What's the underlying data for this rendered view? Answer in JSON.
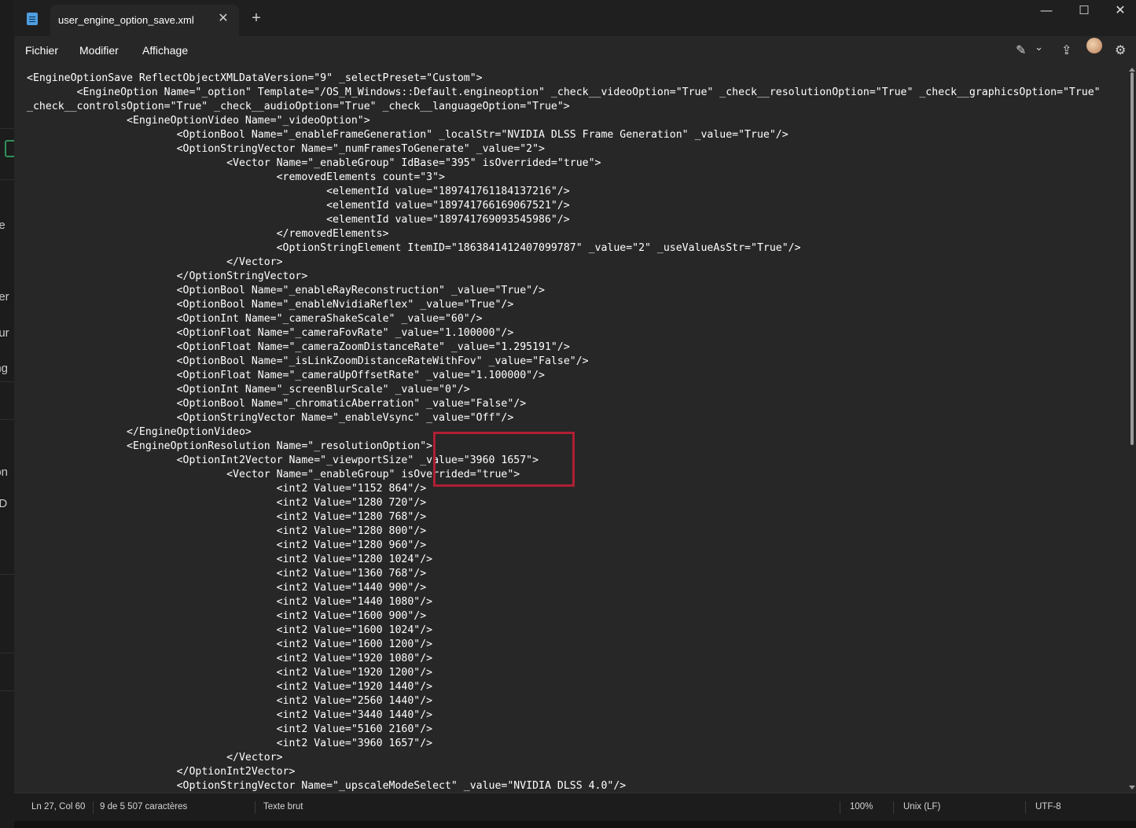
{
  "background_window": {
    "fragments": [
      "ne",
      "ner",
      "our",
      "ing",
      "ion",
      "pD"
    ]
  },
  "titlebar": {
    "tab_title": "user_engine_option_save.xml",
    "close_tab_glyph": "✕",
    "new_tab_glyph": "+",
    "minimize_glyph": "—",
    "maximize_glyph": "☐",
    "close_glyph": "✕"
  },
  "menu": {
    "items": [
      "Fichier",
      "Modifier",
      "Affichage"
    ]
  },
  "toolbar": {
    "copilot_icon": "✎",
    "dropdown_icon": "⌄",
    "share_icon": "⇪",
    "settings_icon": "⚙"
  },
  "document": {
    "lines": [
      "<EngineOptionSave ReflectObjectXMLDataVersion=\"9\" _selectPreset=\"Custom\">",
      "\t<EngineOption Name=\"_option\" Template=\"/OS_M_Windows::Default.engineoption\" _check__videoOption=\"True\" _check__resolutionOption=\"True\" _check__graphicsOption=\"True\"",
      "_check__controlsOption=\"True\" _check__audioOption=\"True\" _check__languageOption=\"True\">",
      "\t\t<EngineOptionVideo Name=\"_videoOption\">",
      "\t\t\t<OptionBool Name=\"_enableFrameGeneration\" _localStr=\"NVIDIA DLSS Frame Generation\" _value=\"True\"/>",
      "\t\t\t<OptionStringVector Name=\"_numFramesToGenerate\" _value=\"2\">",
      "\t\t\t\t<Vector Name=\"_enableGroup\" IdBase=\"395\" isOverrided=\"true\">",
      "\t\t\t\t\t<removedElements count=\"3\">",
      "\t\t\t\t\t\t<elementId value=\"189741761184137216\"/>",
      "\t\t\t\t\t\t<elementId value=\"189741766169067521\"/>",
      "\t\t\t\t\t\t<elementId value=\"189741769093545986\"/>",
      "\t\t\t\t\t</removedElements>",
      "\t\t\t\t\t<OptionStringElement ItemID=\"1863841412407099787\" _value=\"2\" _useValueAsStr=\"True\"/>",
      "\t\t\t\t</Vector>",
      "\t\t\t</OptionStringVector>",
      "\t\t\t<OptionBool Name=\"_enableRayReconstruction\" _value=\"True\"/>",
      "\t\t\t<OptionBool Name=\"_enableNvidiaReflex\" _value=\"True\"/>",
      "\t\t\t<OptionInt Name=\"_cameraShakeScale\" _value=\"60\"/>",
      "\t\t\t<OptionFloat Name=\"_cameraFovRate\" _value=\"1.100000\"/>",
      "\t\t\t<OptionFloat Name=\"_cameraZoomDistanceRate\" _value=\"1.295191\"/>",
      "\t\t\t<OptionBool Name=\"_isLinkZoomDistanceRateWithFov\" _value=\"False\"/>",
      "\t\t\t<OptionFloat Name=\"_cameraUpOffsetRate\" _value=\"1.100000\"/>",
      "\t\t\t<OptionInt Name=\"_screenBlurScale\" _value=\"0\"/>",
      "\t\t\t<OptionBool Name=\"_chromaticAberration\" _value=\"False\"/>",
      "\t\t\t<OptionStringVector Name=\"_enableVsync\" _value=\"Off\"/>",
      "\t\t</EngineOptionVideo>",
      "\t\t<EngineOptionResolution Name=\"_resolutionOption\">",
      "\t\t\t<OptionInt2Vector Name=\"_viewportSize\" _value=\"3960 1657\">",
      "\t\t\t\t<Vector Name=\"_enableGroup\" isOverrided=\"true\">",
      "\t\t\t\t\t<int2 Value=\"1152 864\"/>",
      "\t\t\t\t\t<int2 Value=\"1280 720\"/>",
      "\t\t\t\t\t<int2 Value=\"1280 768\"/>",
      "\t\t\t\t\t<int2 Value=\"1280 800\"/>",
      "\t\t\t\t\t<int2 Value=\"1280 960\"/>",
      "\t\t\t\t\t<int2 Value=\"1280 1024\"/>",
      "\t\t\t\t\t<int2 Value=\"1360 768\"/>",
      "\t\t\t\t\t<int2 Value=\"1440 900\"/>",
      "\t\t\t\t\t<int2 Value=\"1440 1080\"/>",
      "\t\t\t\t\t<int2 Value=\"1600 900\"/>",
      "\t\t\t\t\t<int2 Value=\"1600 1024\"/>",
      "\t\t\t\t\t<int2 Value=\"1600 1200\"/>",
      "\t\t\t\t\t<int2 Value=\"1920 1080\"/>",
      "\t\t\t\t\t<int2 Value=\"1920 1200\"/>",
      "\t\t\t\t\t<int2 Value=\"1920 1440\"/>",
      "\t\t\t\t\t<int2 Value=\"2560 1440\"/>",
      "\t\t\t\t\t<int2 Value=\"3440 1440\"/>",
      "\t\t\t\t\t<int2 Value=\"5160 2160\"/>",
      "\t\t\t\t\t<int2 Value=\"3960 1657\"/>",
      "\t\t\t\t</Vector>",
      "\t\t\t</OptionInt2Vector>",
      "\t\t\t<OptionStringVector Name=\"_upscaleModeSelect\" _value=\"NVIDIA DLSS 4.0\"/>"
    ],
    "selection_text": "3960 1657",
    "selection_line": 27,
    "highlight_color": "#b01f33",
    "selection_color": "#1a5fb4"
  },
  "status": {
    "position": "Ln 27, Col 60",
    "selection_info": "9 de 5 507 caractères",
    "format": "Texte brut",
    "zoom": "100%",
    "line_ending": "Unix (LF)",
    "encoding": "UTF-8"
  }
}
